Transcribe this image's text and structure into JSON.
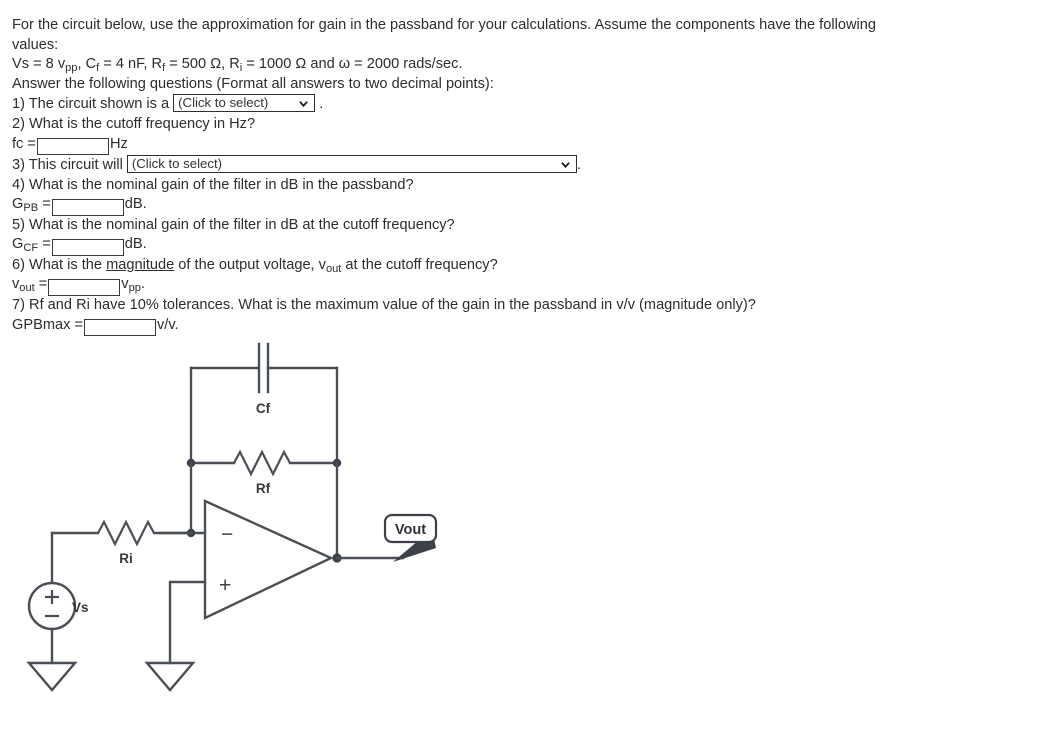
{
  "problem": {
    "intro_line1": "For the circuit below, use the approximation for gain in the passband for your calculations. Assume the components have the following",
    "intro_line2": "values:",
    "values_prefix": "Vs = 8 v",
    "values_sub1": "pp",
    "values_mid1": ", C",
    "values_sub2": "f",
    "values_mid2": " = 4 nF, R",
    "values_sub3": "f",
    "values_mid3": " = 500 Ω, R",
    "values_sub4": "i",
    "values_mid4": " = 1000 Ω and ω = 2000 rads/sec.",
    "format_note": "Answer the following questions (Format all answers to two decimal points):"
  },
  "questions": {
    "q1_text": "1) The circuit shown is a",
    "q1_select_value": "(Click to select)",
    "q1_period": ".",
    "q2_text": "2) What is the cutoff frequency in Hz?",
    "q2_label": "fc =",
    "q2_value": "",
    "q2_unit": "Hz",
    "q3_text": "3) This circuit will",
    "q3_select_value": "(Click to select)",
    "q3_period": ".",
    "q4_text": "4) What is the nominal gain of the filter in dB in the passband?",
    "q4_label_main": "G",
    "q4_label_sub": "PB",
    "q4_eq": "=",
    "q4_value": "",
    "q4_unit": "dB.",
    "q5_text": "5) What is the nominal gain of the filter in dB at the cutoff frequency?",
    "q5_label_main": "G",
    "q5_label_sub": "CF",
    "q5_eq": "=",
    "q5_value": "",
    "q5_unit": "dB.",
    "q6_text_a": "6) What is the ",
    "q6_text_underlined": "magnitude",
    "q6_text_b": " of the output voltage, v",
    "q6_text_sub": "out",
    "q6_text_c": " at the cutoff frequency?",
    "q6_label_main": "v",
    "q6_label_sub": "out",
    "q6_eq": "=",
    "q6_value": "",
    "q6_unit_main": "v",
    "q6_unit_sub": "pp",
    "q6_unit_period": ".",
    "q7_text": "7) Rf and Ri have 10% tolerances. What is the maximum value of the gain in the passband in v/v (magnitude only)?",
    "q7_label": "GPBmax =",
    "q7_value": "",
    "q7_unit": "v/v."
  },
  "circuit": {
    "label_cf": "Cf",
    "label_rf": "Rf",
    "label_ri": "Ri",
    "label_vs": "Vs",
    "label_vout": "Vout",
    "label_minus": "−",
    "label_plus": "+",
    "source_plus": "+",
    "source_minus": "−",
    "wire_color": "#4a4f57"
  }
}
